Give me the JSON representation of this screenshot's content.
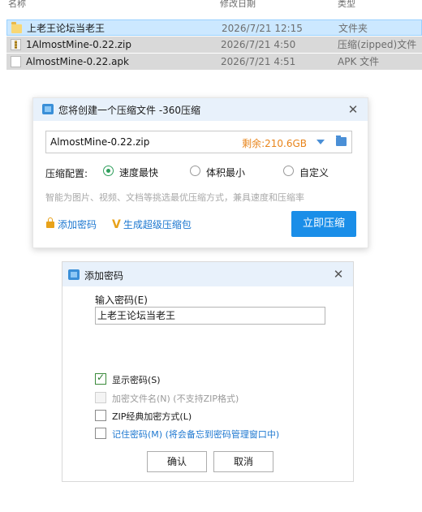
{
  "explorer": {
    "columns": {
      "name": "名称",
      "date": "修改日期",
      "type": "类型"
    },
    "rows": [
      {
        "name": "上老王论坛当老王",
        "date": "2026/7/21 12:15",
        "type": "文件夹",
        "icon": "folder-icon"
      },
      {
        "name": "1AlmostMine-0.22.zip",
        "date": "2026/7/21 4:50",
        "type": "压缩(zipped)文件",
        "icon": "zip-icon"
      },
      {
        "name": "AlmostMine-0.22.apk",
        "date": "2026/7/21 4:51",
        "type": "APK 文件",
        "icon": "apk-icon"
      }
    ]
  },
  "compress_dialog": {
    "title": "您将创建一个压缩文件 -360压缩",
    "close": "✕",
    "filename": "AlmostMine-0.22.zip",
    "free_space": "剩余:210.6GB",
    "config_label": "压缩配置:",
    "options": [
      {
        "label": "速度最快",
        "selected": true
      },
      {
        "label": "体积最小",
        "selected": false
      },
      {
        "label": "自定义",
        "selected": false
      }
    ],
    "hint": "智能为图片、视频、文档等挑选最优压缩方式，兼具速度和压缩率",
    "add_password": "添加密码",
    "super_package": "生成超级压缩包",
    "compress_button": "立即压缩"
  },
  "password_dialog": {
    "title": "添加密码",
    "close": "✕",
    "input_label": "输入密码(E)",
    "input_value": "上老王论坛当老王",
    "checkboxes": [
      {
        "label": "显示密码(S)",
        "checked": true,
        "disabled": false
      },
      {
        "label": "加密文件名(N) (不支持ZIP格式)",
        "checked": false,
        "disabled": true
      },
      {
        "label": "ZIP经典加密方式(L)",
        "checked": false,
        "disabled": false
      },
      {
        "label": "记住密码(M) (将会备忘到密码管理窗口中)",
        "checked": false,
        "disabled": false
      }
    ],
    "ok_button": "确认",
    "cancel_button": "取消"
  },
  "colors": {
    "selection": "#cce8ff",
    "accent_blue": "#1a8ee8",
    "free_space_orange": "#e8841a",
    "radio_green": "#2e9e5b"
  }
}
